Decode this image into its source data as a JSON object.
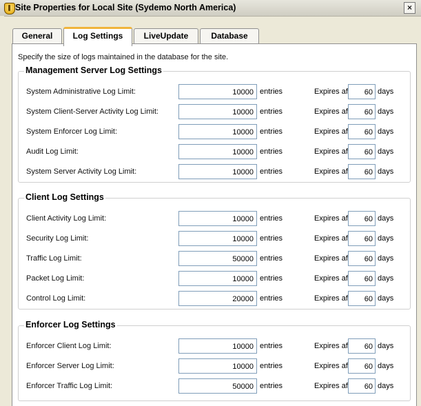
{
  "window": {
    "title": "Site Properties for Local Site (Sydemo North America)",
    "close_glyph": "×"
  },
  "tabs": [
    {
      "label": "General",
      "active": false
    },
    {
      "label": "Log Settings",
      "active": true
    },
    {
      "label": "LiveUpdate",
      "active": false
    },
    {
      "label": "Database",
      "active": false
    }
  ],
  "description": "Specify the size of logs maintained in the database for the site.",
  "unit_entries": "entries",
  "expires_label": "Expires after:",
  "unit_days": "days",
  "groups": [
    {
      "title": "Management Server Log Settings",
      "rows": [
        {
          "label": "System Administrative Log Limit:",
          "limit": "10000",
          "days": "60"
        },
        {
          "label": "System Client-Server Activity Log Limit:",
          "limit": "10000",
          "days": "60"
        },
        {
          "label": "System Enforcer Log Limit:",
          "limit": "10000",
          "days": "60"
        },
        {
          "label": "Audit Log Limit:",
          "limit": "10000",
          "days": "60"
        },
        {
          "label": "System Server Activity Log Limit:",
          "limit": "10000",
          "days": "60"
        }
      ]
    },
    {
      "title": "Client Log Settings",
      "rows": [
        {
          "label": "Client Activity Log Limit:",
          "limit": "10000",
          "days": "60"
        },
        {
          "label": "Security Log Limit:",
          "limit": "10000",
          "days": "60"
        },
        {
          "label": "Traffic Log Limit:",
          "limit": "50000",
          "days": "60"
        },
        {
          "label": "Packet Log Limit:",
          "limit": "10000",
          "days": "60"
        },
        {
          "label": "Control Log Limit:",
          "limit": "20000",
          "days": "60"
        }
      ]
    },
    {
      "title": "Enforcer Log Settings",
      "rows": [
        {
          "label": "Enforcer Client Log Limit:",
          "limit": "10000",
          "days": "60"
        },
        {
          "label": "Enforcer Server Log Limit:",
          "limit": "10000",
          "days": "60"
        },
        {
          "label": "Enforcer Traffic Log Limit:",
          "limit": "50000",
          "days": "60"
        }
      ]
    }
  ]
}
